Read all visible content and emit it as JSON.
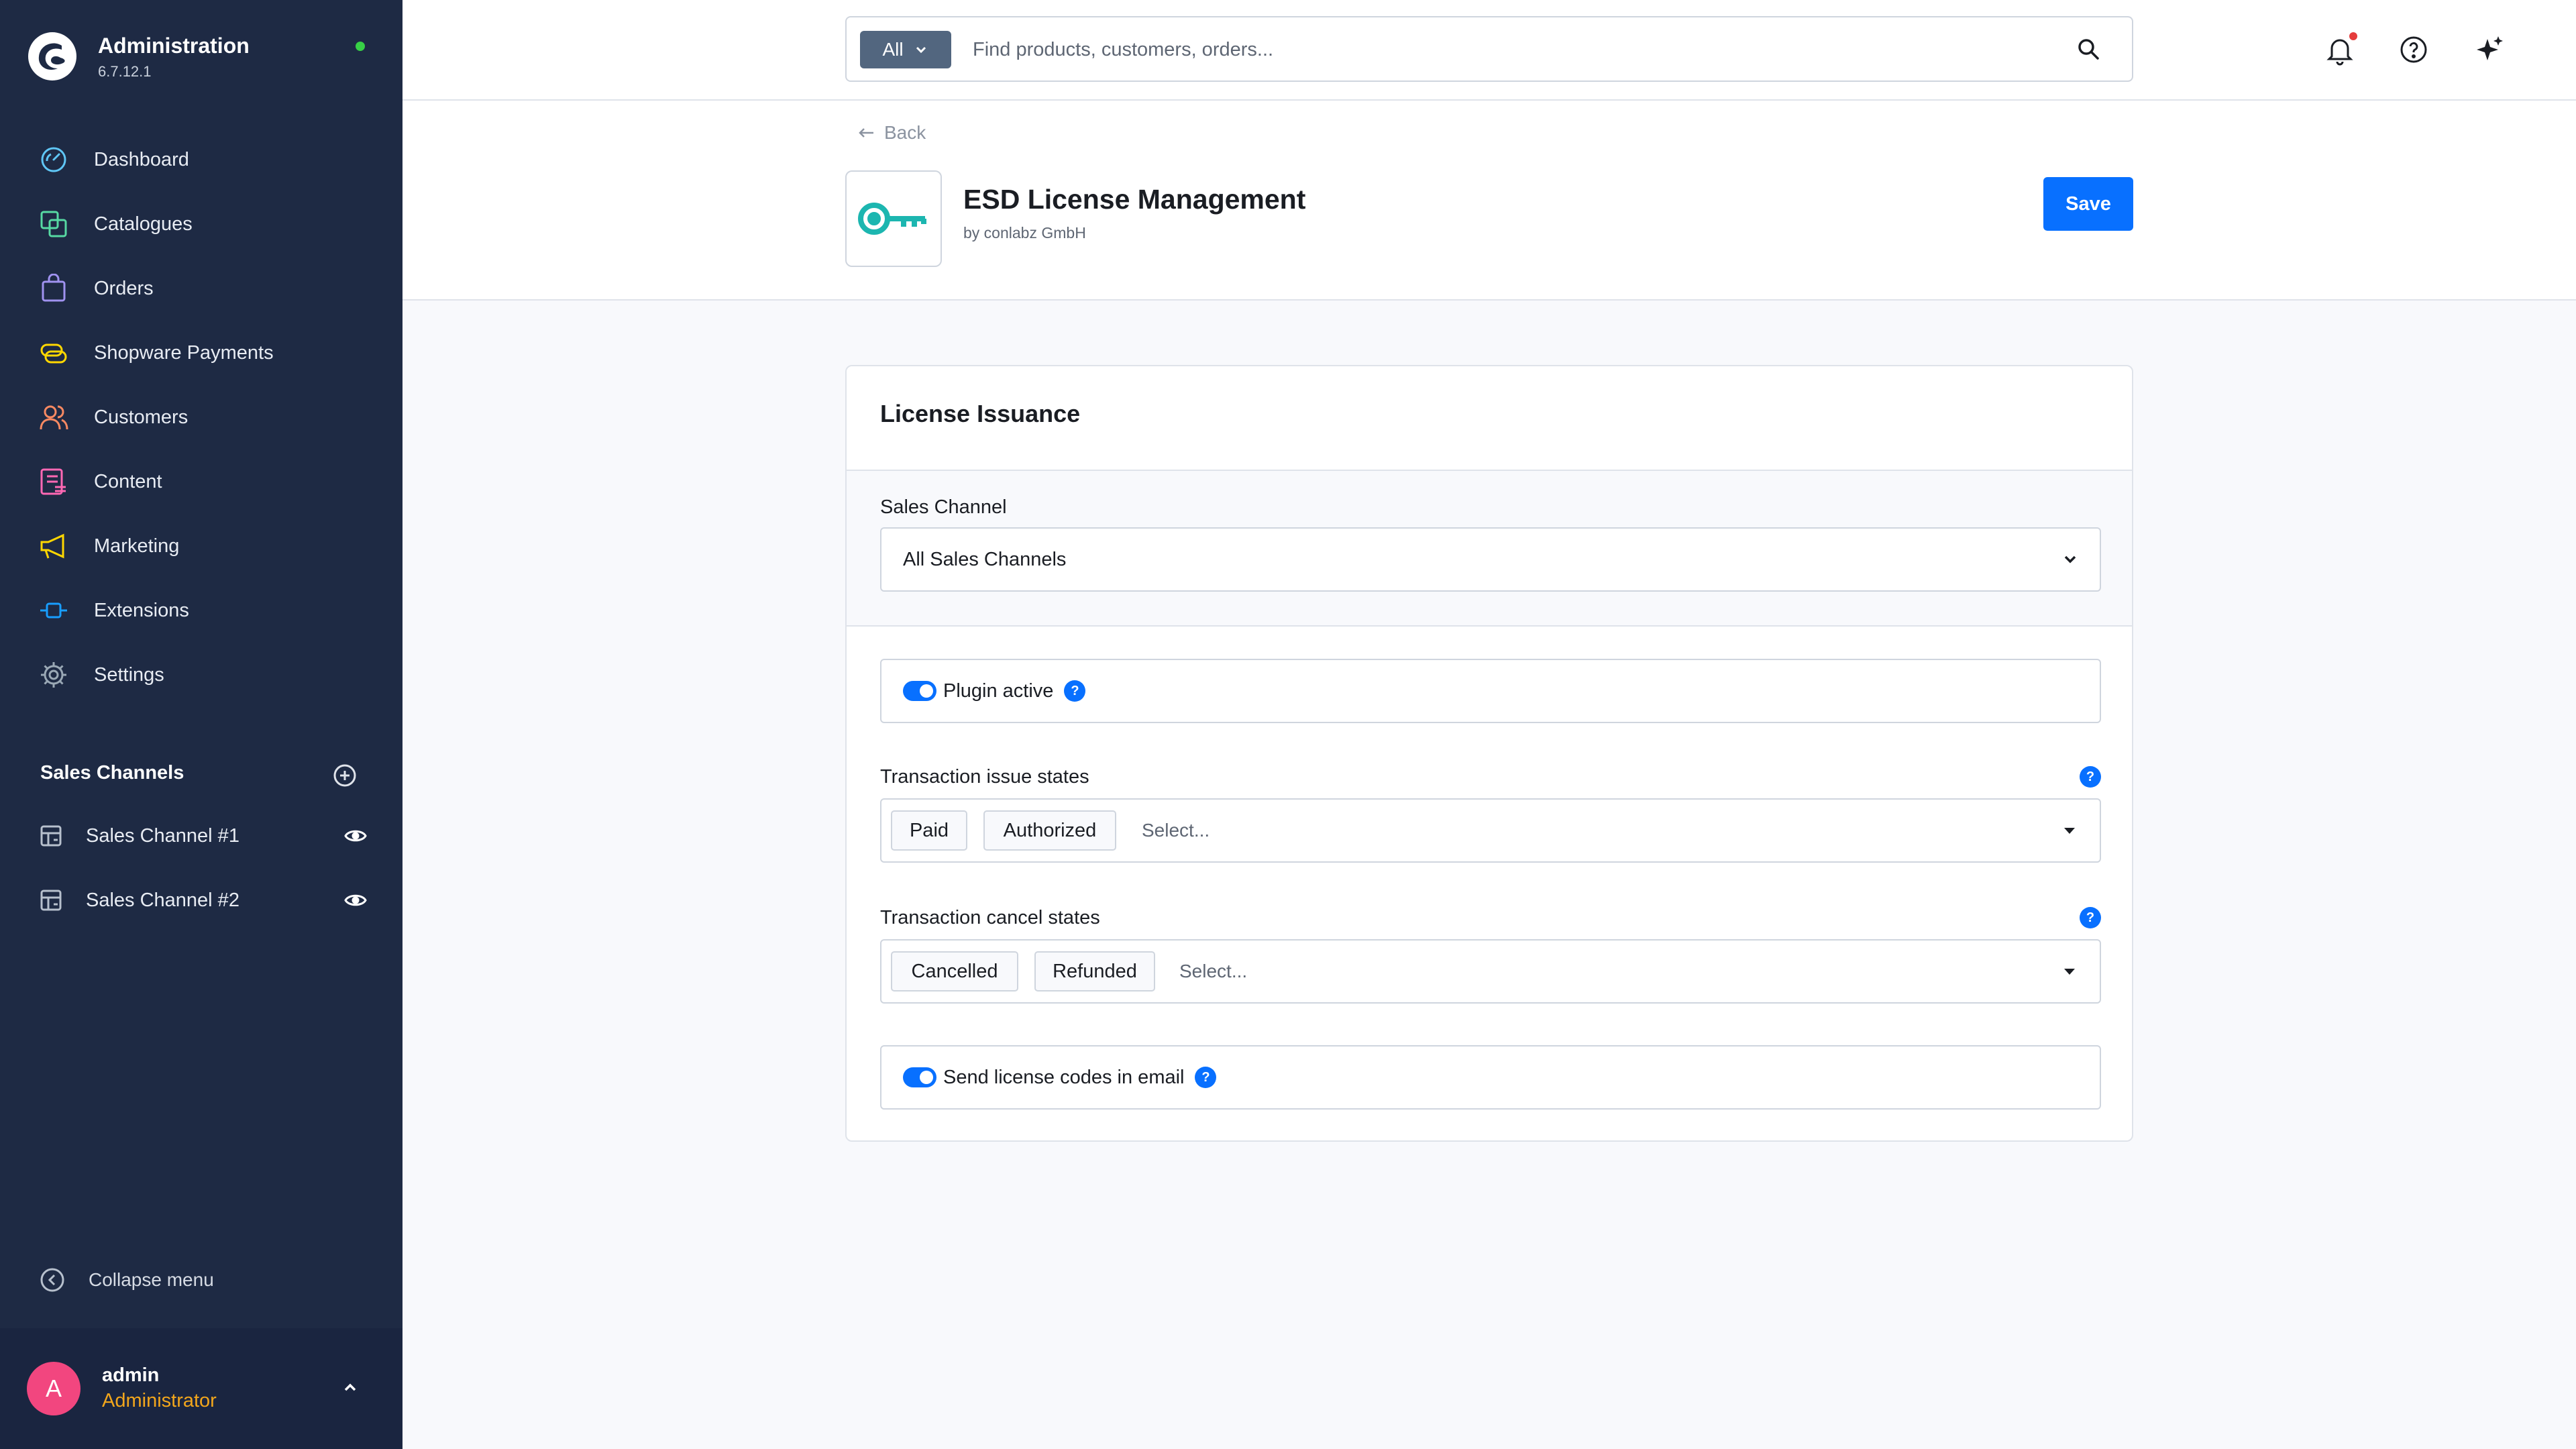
{
  "sidebar": {
    "brand_title": "Administration",
    "brand_version": "6.7.12.1",
    "nav": [
      {
        "label": "Dashboard",
        "icon": "dashboard-icon",
        "color": "#5fc6f5"
      },
      {
        "label": "Catalogues",
        "icon": "catalogue-icon",
        "color": "#57d9a3"
      },
      {
        "label": "Orders",
        "icon": "orders-icon",
        "color": "#a092f0"
      },
      {
        "label": "Shopware Payments",
        "icon": "payments-icon",
        "color": "#ffd700"
      },
      {
        "label": "Customers",
        "icon": "customers-icon",
        "color": "#f88962"
      },
      {
        "label": "Content",
        "icon": "content-icon",
        "color": "#ff68b4"
      },
      {
        "label": "Marketing",
        "icon": "marketing-icon",
        "color": "#ffd700"
      },
      {
        "label": "Extensions",
        "icon": "extensions-icon",
        "color": "#189eff"
      },
      {
        "label": "Settings",
        "icon": "settings-icon",
        "color": "#9aa8b5"
      }
    ],
    "sales_channels_heading": "Sales Channels",
    "sales_channels": [
      {
        "label": "Sales Channel #1"
      },
      {
        "label": "Sales Channel #2"
      }
    ],
    "collapse_label": "Collapse menu",
    "user": {
      "initial": "A",
      "name": "admin",
      "role": "Administrator"
    }
  },
  "search": {
    "type_label": "All",
    "placeholder": "Find products, customers, orders..."
  },
  "header": {
    "back_label": "Back",
    "title": "ESD License Management",
    "vendor": "by conlabz GmbH",
    "save_label": "Save"
  },
  "card": {
    "title": "License Issuance",
    "sales_channel_label": "Sales Channel",
    "sales_channel_value": "All Sales Channels",
    "plugin_active_label": "Plugin active",
    "issue_states_label": "Transaction issue states",
    "issue_states": [
      "Paid",
      "Authorized"
    ],
    "cancel_states_label": "Transaction cancel states",
    "cancel_states": [
      "Cancelled",
      "Refunded"
    ],
    "select_placeholder": "Select...",
    "send_codes_label": "Send license codes in email",
    "help_glyph": "?"
  },
  "colors": {
    "accent": "#0870ff",
    "sidebar_bg": "#1e2a44",
    "status_online": "#37d046",
    "role_color": "#f2a61c",
    "avatar": "#f2467f",
    "extension_logo": "#1cb6b0"
  }
}
